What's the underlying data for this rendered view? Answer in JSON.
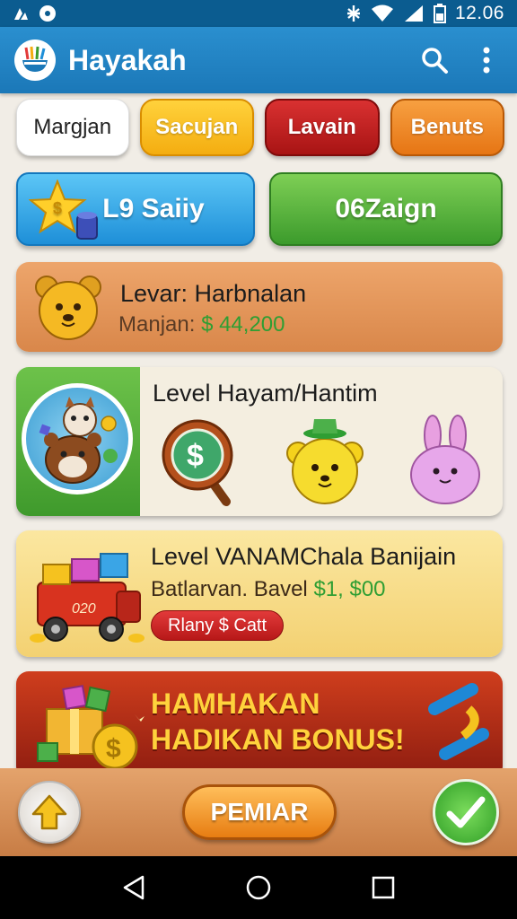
{
  "status_bar": {
    "time": "12.06",
    "left_icons": [
      "drive-icon",
      "record-icon"
    ],
    "right_icons": [
      "bluetooth-icon",
      "wifi-icon",
      "signal-icon",
      "battery-icon"
    ]
  },
  "app_bar": {
    "title": "Hayakah",
    "actions": [
      "search-icon",
      "more-vert-icon"
    ],
    "color": "#1f80c2"
  },
  "tabs": [
    {
      "label": "Margjan",
      "selected": true
    },
    {
      "label": "Sacujan",
      "selected": false
    },
    {
      "label": "Lavain",
      "selected": false
    },
    {
      "label": "Benuts",
      "selected": false
    }
  ],
  "big_buttons": {
    "blue_label": "L9 Saiiy",
    "green_label": "06Zaign"
  },
  "cards": {
    "card1": {
      "title": "Levar: Harbnalan",
      "sub_label": "Manjan:",
      "sub_value": "$ 44,200"
    },
    "card2": {
      "title": "Level Hayam/Hantim"
    },
    "card3": {
      "title": "Level VANAMChala Banijain",
      "sub_label": "Batlarvan. Bavel",
      "sub_value": "$1, $00",
      "pill": "Rlany $ Catt"
    },
    "card4": {
      "line1": "HAMHAKAN",
      "line2": "HADIKAN BONUS!"
    }
  },
  "game_bar": {
    "play_label": "PEMIAR",
    "left_icon": "arrow-up-icon",
    "right_icon": "check-icon"
  },
  "nav_bar": {
    "icons": [
      "back-icon",
      "home-icon",
      "recents-icon"
    ]
  }
}
